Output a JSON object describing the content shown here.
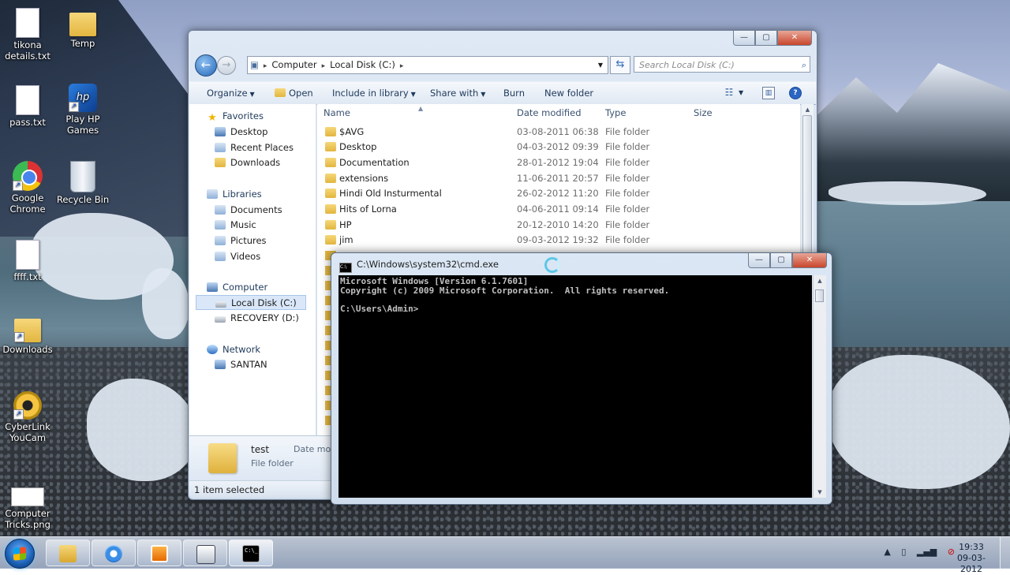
{
  "desktop": {
    "icons": [
      {
        "label": "tikona details.txt"
      },
      {
        "label": "Temp"
      },
      {
        "label": "pass.txt"
      },
      {
        "label": "Play HP Games"
      },
      {
        "label": "Google Chrome"
      },
      {
        "label": "Recycle Bin"
      },
      {
        "label": "ffff.txt"
      },
      {
        "label": "Downloads"
      },
      {
        "label": "CyberLink YouCam"
      },
      {
        "label": "Computer Tricks.png"
      }
    ]
  },
  "explorer": {
    "caption": {
      "minimize": "—",
      "maximize": "▢",
      "close": "✕"
    },
    "breadcrumb": [
      "Computer",
      "Local Disk (C:)"
    ],
    "search_placeholder": "Search Local Disk (C:)",
    "toolbar": {
      "organize": "Organize",
      "open": "Open",
      "include_in_library": "Include in library",
      "share_with": "Share with",
      "burn": "Burn",
      "new_folder": "New folder"
    },
    "nav": {
      "favorites": "Favorites",
      "desktop": "Desktop",
      "recent_places": "Recent Places",
      "downloads": "Downloads",
      "libraries": "Libraries",
      "documents": "Documents",
      "music": "Music",
      "pictures": "Pictures",
      "videos": "Videos",
      "computer": "Computer",
      "local_disk": "Local Disk (C:)",
      "recovery": "RECOVERY (D:)",
      "network": "Network",
      "santan": "SANTAN"
    },
    "columns": {
      "name": "Name",
      "date_modified": "Date modified",
      "type": "Type",
      "size": "Size"
    },
    "files": [
      {
        "name": "$AVG",
        "date": "03-08-2011 06:38",
        "type": "File folder"
      },
      {
        "name": "Desktop",
        "date": "04-03-2012 09:39",
        "type": "File folder"
      },
      {
        "name": "Documentation",
        "date": "28-01-2012 19:04",
        "type": "File folder"
      },
      {
        "name": "extensions",
        "date": "11-06-2011 20:57",
        "type": "File folder"
      },
      {
        "name": "Hindi Old Insturmental",
        "date": "26-02-2012 11:20",
        "type": "File folder"
      },
      {
        "name": "Hits of Lorna",
        "date": "04-06-2011 09:14",
        "type": "File folder"
      },
      {
        "name": "HP",
        "date": "20-12-2010 14:20",
        "type": "File folder"
      },
      {
        "name": "jim",
        "date": "09-03-2012 19:32",
        "type": "File folder"
      }
    ],
    "details": {
      "name": "test",
      "type": "File folder",
      "date_label": "Date mod"
    },
    "status": "1 item selected"
  },
  "cmd": {
    "title": "C:\\Windows\\system32\\cmd.exe",
    "lines": [
      "Microsoft Windows [Version 6.1.7601]",
      "Copyright (c) 2009 Microsoft Corporation.  All rights reserved.",
      "",
      "C:\\Users\\Admin>"
    ]
  },
  "taskbar": {
    "time": "19:33",
    "date": "09-03-2012"
  }
}
